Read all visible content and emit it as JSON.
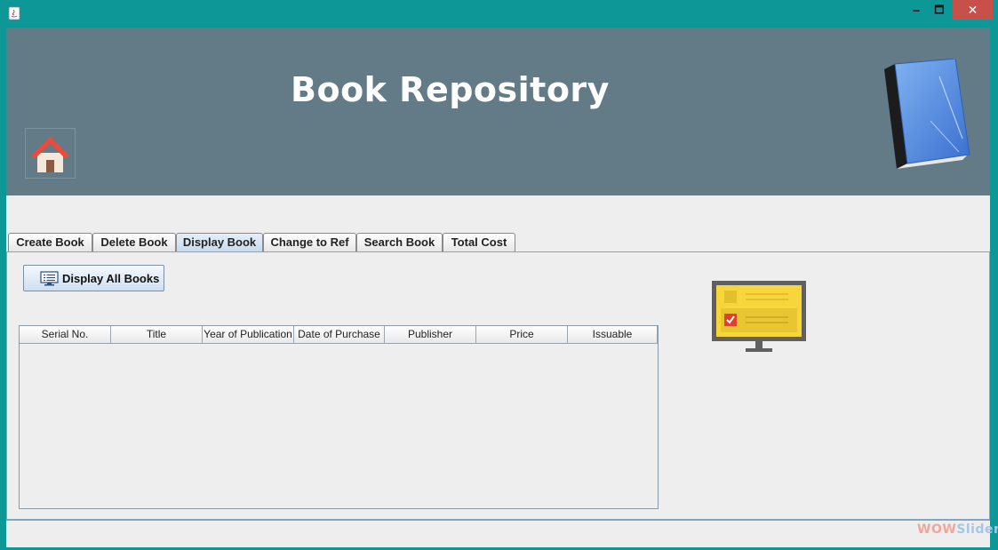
{
  "window": {
    "controls": {
      "minimize": "🗕",
      "maximize": "🗖",
      "close": "✕"
    }
  },
  "banner": {
    "title": "Book Repository",
    "home_icon": "home-icon",
    "logo_icon": "book-icon"
  },
  "tabs": [
    {
      "label": "Create Book",
      "selected": false
    },
    {
      "label": "Delete Book",
      "selected": false
    },
    {
      "label": "Display Book",
      "selected": true
    },
    {
      "label": "Change to Ref",
      "selected": false
    },
    {
      "label": "Search Book",
      "selected": false
    },
    {
      "label": "Total Cost",
      "selected": false
    }
  ],
  "display_panel": {
    "button_label": "Display All Books",
    "button_icon": "monitor-list-icon",
    "table": {
      "columns": [
        "Serial No.",
        "Title",
        "Year of Publication",
        "Date of Purchase",
        "Publisher",
        "Price",
        "Issuable"
      ],
      "rows": []
    },
    "illustration": "monitor-checklist-icon"
  },
  "watermark": {
    "part1": "WOW",
    "part2": "Slider"
  },
  "colors": {
    "window_border": "#0d9796",
    "banner": "#627b87",
    "panel": "#eeeeee",
    "close_button": "#c7504a"
  }
}
